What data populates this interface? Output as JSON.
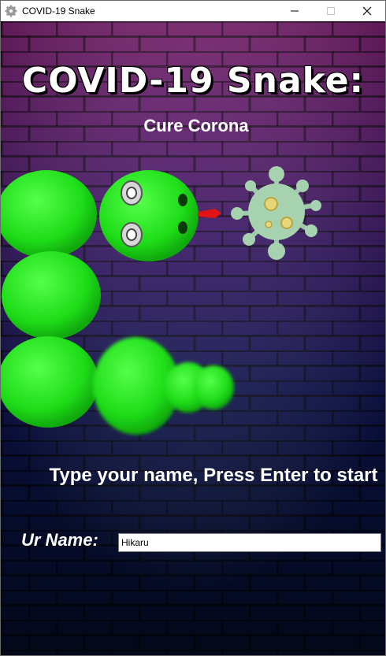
{
  "window": {
    "title": "COVID-19 Snake",
    "icon": "gear-icon"
  },
  "game": {
    "title": "COVID-19 Snake:",
    "subtitle": "Cure Corona",
    "prompt": "Type your name, Press Enter to start",
    "name_label": "Ur Name:",
    "name_value": "Hikaru"
  },
  "colors": {
    "snake": "#22e01e",
    "virus": "#a7d2b0",
    "tongue": "#e01414",
    "bg_top": "#7a1f6e",
    "bg_bottom": "#040a22"
  }
}
